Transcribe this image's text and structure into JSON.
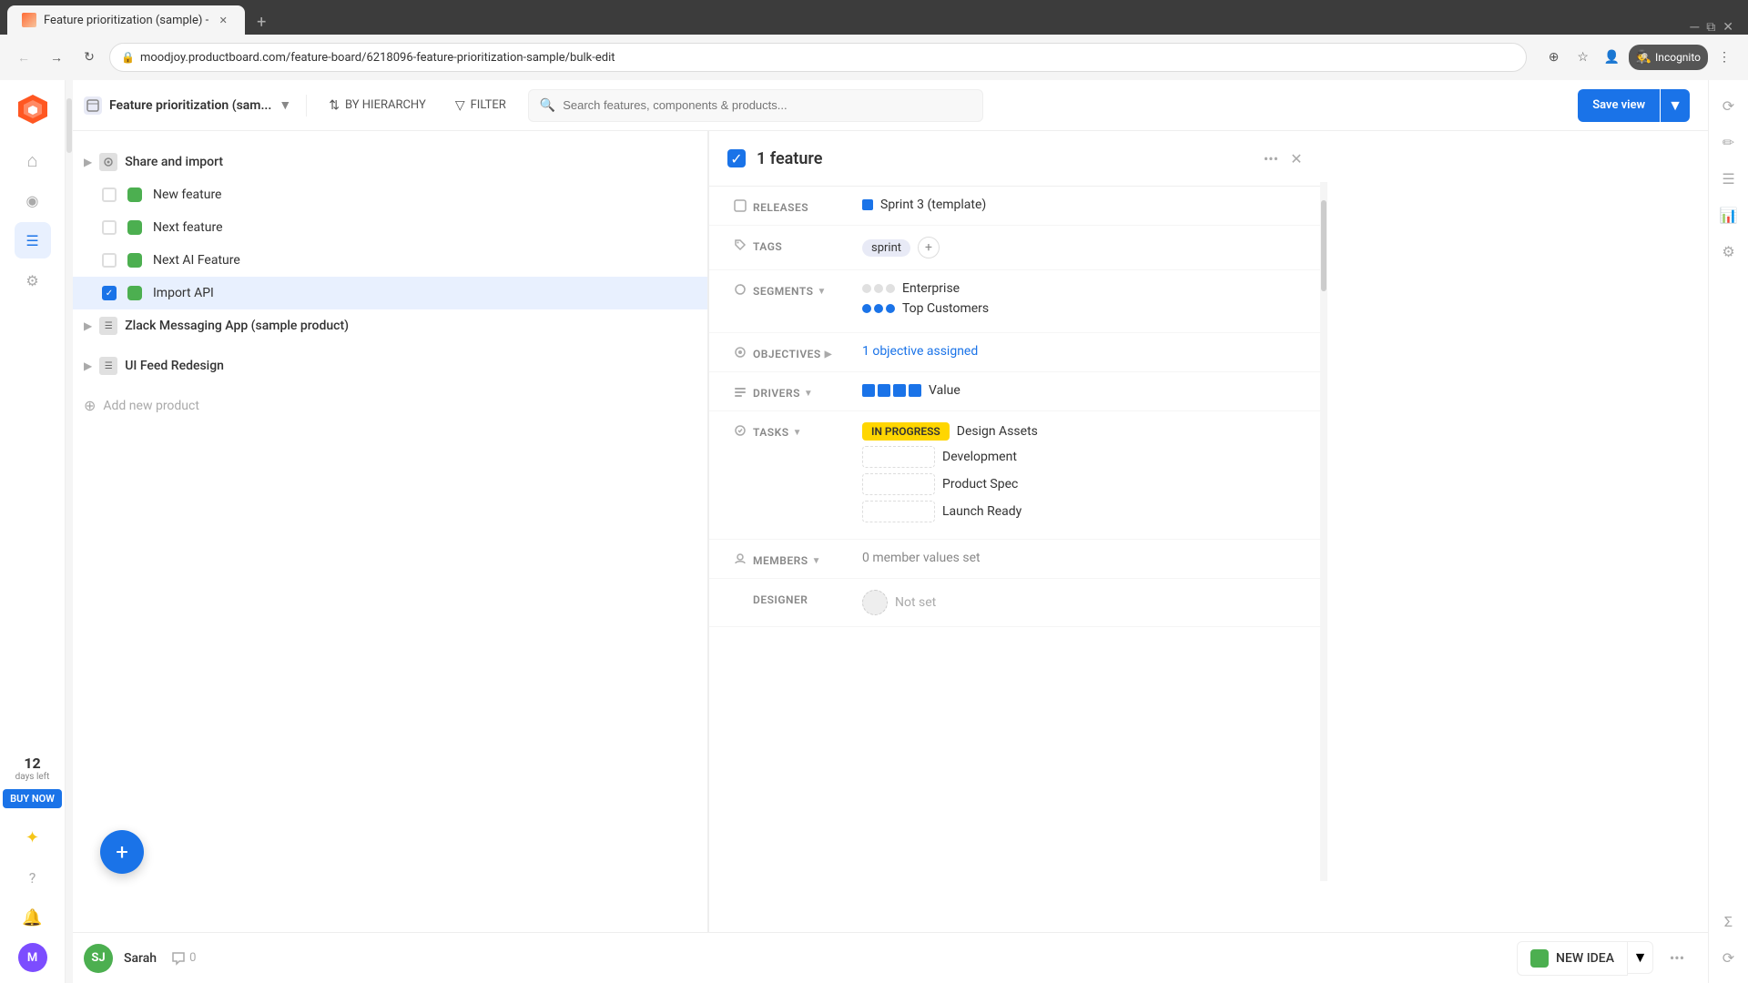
{
  "browser": {
    "tab_title": "Feature prioritization (sample) -",
    "url": "moodjoy.productboard.com/feature-board/6218096-feature-prioritization-sample/bulk-edit",
    "new_tab_label": "+",
    "incognito_label": "Incognito"
  },
  "topbar": {
    "feature_title": "Feature prioritization (sam...",
    "hierarchy_label": "BY HIERARCHY",
    "filter_label": "FILTER",
    "search_placeholder": "Search features, components & products...",
    "save_view_label": "Save view"
  },
  "features": {
    "share_and_import": "Share and import",
    "items": [
      {
        "name": "New feature",
        "color": "#4caf50",
        "checked": false
      },
      {
        "name": "Next feature",
        "color": "#4caf50",
        "checked": false
      },
      {
        "name": "Next AI Feature",
        "color": "#4caf50",
        "checked": false
      },
      {
        "name": "Import API",
        "color": "#4caf50",
        "checked": true
      }
    ],
    "product_groups": [
      {
        "name": "Zlack Messaging App (sample product)"
      },
      {
        "name": "UI Feed Redesign"
      }
    ],
    "add_product_label": "Add new product"
  },
  "detail_panel": {
    "header": {
      "count": "1 feature",
      "more_icon": "•••",
      "close_icon": "✕"
    },
    "fields": {
      "releases_label": "RELEASES",
      "releases_value": "Sprint 3 (template)",
      "tags_label": "TAGS",
      "tags": [
        "sprint"
      ],
      "segments_label": "SEGMENTS",
      "segments": [
        {
          "name": "Enterprise",
          "dots": [
            false,
            false,
            false
          ]
        },
        {
          "name": "Top Customers",
          "dots": [
            true,
            true,
            true
          ]
        }
      ],
      "objectives_label": "OBJECTIVES",
      "objectives_value": "1 objective assigned",
      "drivers_label": "DRIVERS",
      "drivers_dots": 4,
      "drivers_value": "Value",
      "tasks_label": "TASKS",
      "tasks": [
        {
          "badge": "IN PROGRESS",
          "name": "Design Assets",
          "has_badge": true
        },
        {
          "name": "Development",
          "has_badge": false
        },
        {
          "name": "Product Spec",
          "has_badge": false
        },
        {
          "name": "Launch Ready",
          "has_badge": false
        }
      ],
      "members_label": "MEMBERS",
      "members_value": "0 member values set",
      "designer_label": "DESIGNER",
      "designer_value": "Not set"
    }
  },
  "bottom_bar": {
    "user_initials": "SJ",
    "user_name": "Sarah",
    "comment_count": "0",
    "new_idea_label": "NEW IDEA"
  },
  "sidebar": {
    "logo_text": "P",
    "days_number": "12",
    "days_label": "days left",
    "buy_now_label": "BUY NOW",
    "nav_items": [
      {
        "icon": "⌂",
        "name": "home-icon"
      },
      {
        "icon": "◎",
        "name": "search-icon"
      },
      {
        "icon": "≡",
        "name": "list-icon",
        "active": true
      },
      {
        "icon": "⚡",
        "name": "integration-icon"
      },
      {
        "icon": "✦",
        "name": "sparkle-icon"
      },
      {
        "icon": "?",
        "name": "help-icon"
      },
      {
        "icon": "🔔",
        "name": "bell-icon"
      }
    ]
  }
}
